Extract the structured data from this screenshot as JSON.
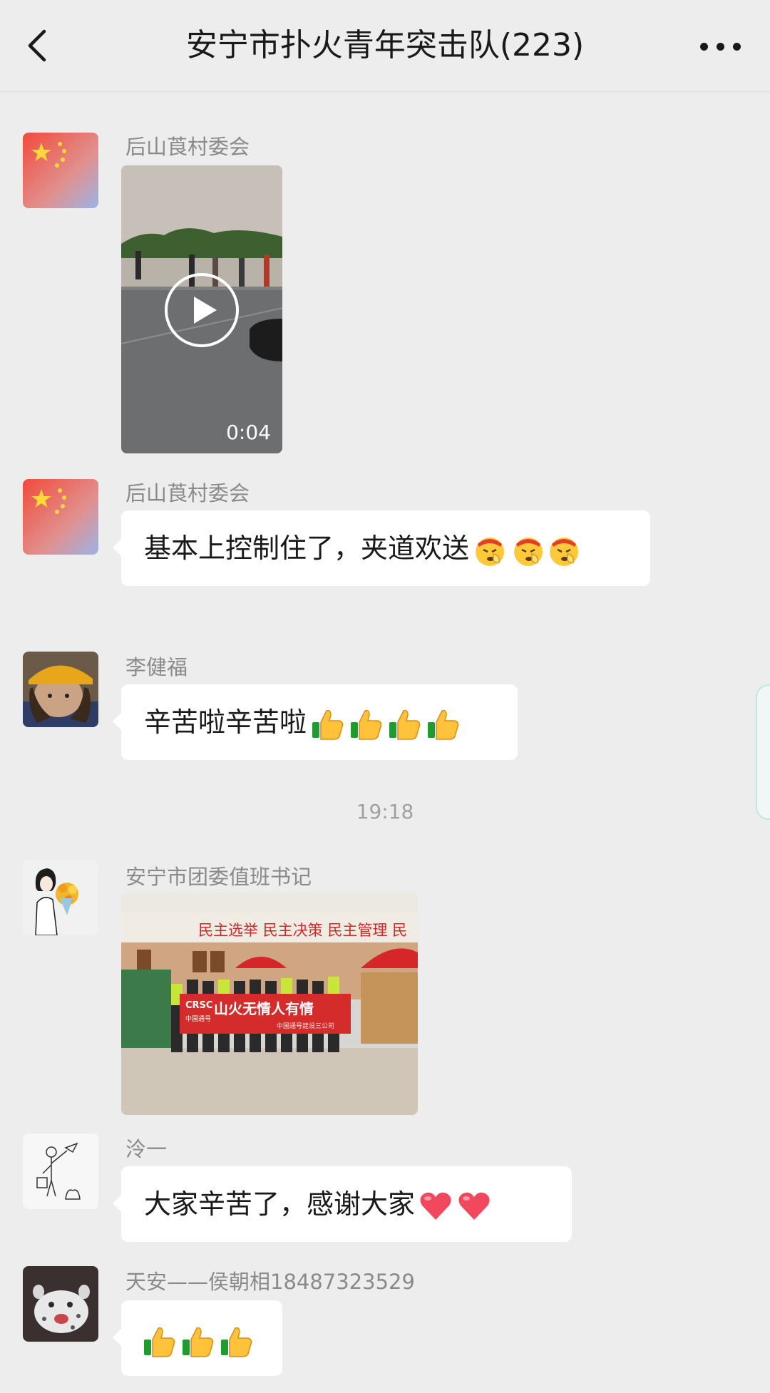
{
  "header": {
    "title": "安宁市扑火青年突击队(223)"
  },
  "messages": [
    {
      "sender": "后山莨村委会",
      "type": "video",
      "duration": "0:04"
    },
    {
      "sender": "后山莨村委会",
      "type": "text",
      "text": "基本上控制住了，夹道欢送",
      "emoji": [
        "salute-face-emoji",
        "salute-face-emoji",
        "salute-face-emoji"
      ]
    },
    {
      "sender": "李健福",
      "type": "text",
      "text": "辛苦啦辛苦啦",
      "emoji": [
        "thumbs-up-emoji",
        "thumbs-up-emoji",
        "thumbs-up-emoji",
        "thumbs-up-emoji"
      ]
    },
    {
      "timestamp": "19:18"
    },
    {
      "sender": "安宁市团委值班书记",
      "type": "image",
      "image": {
        "slogan": "民主选举 民主决策 民主管理 民",
        "banner_logo": "CRSC",
        "banner_logo_sub": "中国通号",
        "banner_text": "山火无情人有情",
        "banner_sub": "中国通号建设三公司"
      }
    },
    {
      "sender": "泠一",
      "type": "text",
      "text": "大家辛苦了，感谢大家",
      "emoji": [
        "heart-emoji",
        "heart-emoji"
      ]
    },
    {
      "sender": "天安——侯朝相18487323529",
      "type": "text",
      "text": "",
      "emoji": [
        "thumbs-up-emoji",
        "thumbs-up-emoji",
        "thumbs-up-emoji"
      ]
    }
  ],
  "colors": {
    "background": "#ededed",
    "bubble": "#ffffff",
    "sender_name": "#8a8a8a",
    "timestamp": "#a0a0a0",
    "banner_red": "#d42b2b"
  }
}
